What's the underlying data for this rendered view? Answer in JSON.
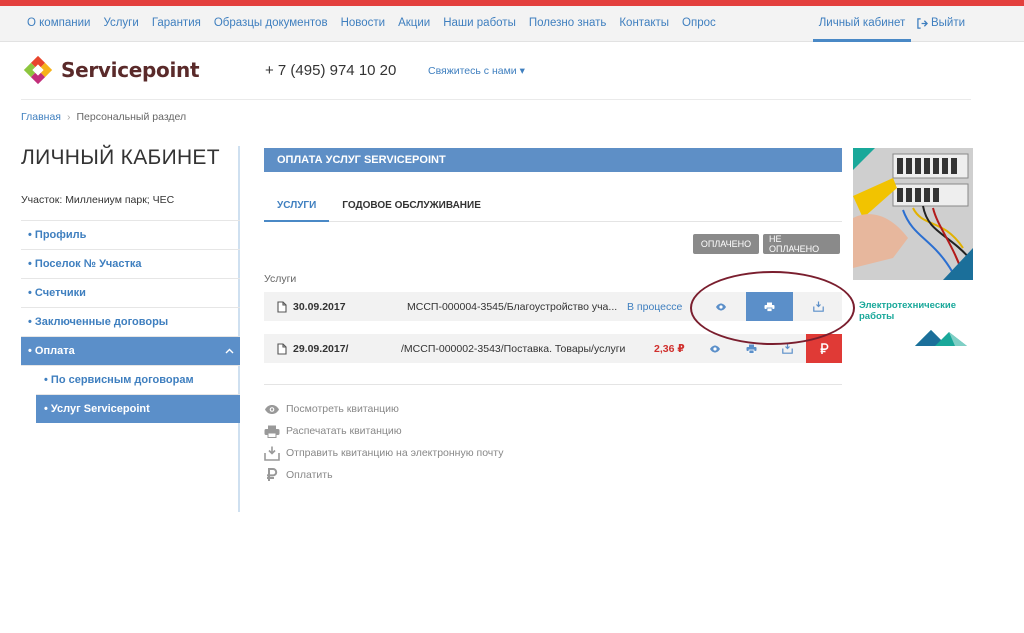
{
  "topnav": {
    "items": [
      "О компании",
      "Услуги",
      "Гарантия",
      "Образцы документов",
      "Новости",
      "Акции",
      "Наши работы",
      "Полезно знать",
      "Контакты",
      "Опрос"
    ],
    "cabinet": "Личный кабинет",
    "logout": "Выйти"
  },
  "header": {
    "logo_text": "Servicepoint",
    "phone": "+ 7 (495) 974 10 20",
    "contact": "Свяжитесь с нами ▾"
  },
  "breadcrumb": {
    "home": "Главная",
    "sep": "›",
    "current": "Персональный раздел"
  },
  "sidebar": {
    "title": "ЛИЧНЫЙ КАБИНЕТ",
    "plot": "Участок: Миллениум парк; ЧЕС",
    "items": [
      "• Профиль",
      "• Поселок № Участка",
      "• Счетчики",
      "• Заключенные договоры",
      "• Оплата"
    ],
    "active_chevron": "ˆ",
    "subitems": [
      "• По сервисным договорам",
      "• Услуг Servicepoint"
    ]
  },
  "main": {
    "section_title": "ОПЛАТА УСЛУГ SERVICEPOINT",
    "tabs": [
      "УСЛУГИ",
      "ГОДОВОЕ ОБСЛУЖИВАНИЕ"
    ],
    "filters": [
      "ОПЛАЧЕНО",
      "НЕ ОПЛАЧЕНО"
    ],
    "list_label": "Услуги",
    "rows": [
      {
        "date": "30.09.2017",
        "title": "МССП-000004-3545/Благоустройство уча...",
        "status": "В процессе"
      },
      {
        "date": "29.09.2017/",
        "title": "/МССП-000002-3543/Поставка. Товары/услуги",
        "amount": "2,36 ₽"
      }
    ],
    "legend": [
      "Посмотреть квитанцию",
      "Распечатать квитанцию",
      "Отправить квитанцию на электронную почту",
      "Оплатить"
    ]
  },
  "banner": {
    "title_line1": "Электротехнические",
    "title_line2": "работы"
  },
  "colors": {
    "accent": "#5b8fc9",
    "link": "#3f7fbf",
    "pay": "#e03a36",
    "brand_red": "#e3403d",
    "teal": "#19a89a"
  }
}
